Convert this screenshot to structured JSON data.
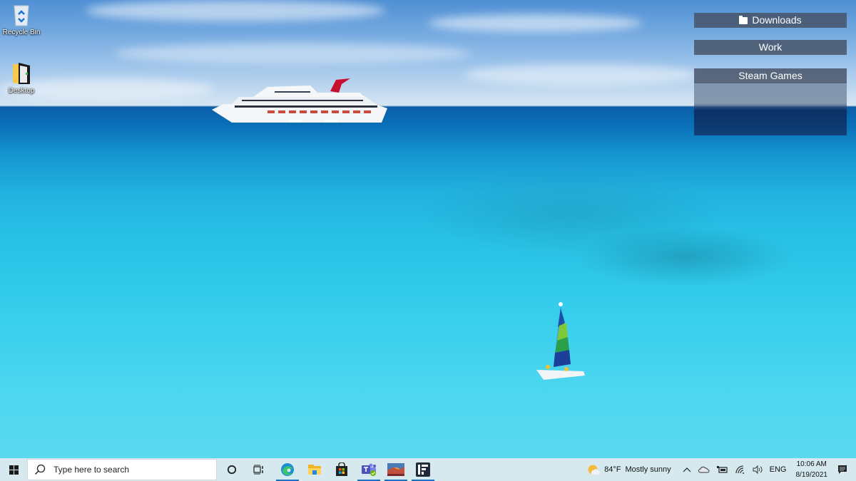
{
  "desktop": {
    "icons": [
      {
        "label": "Recycle Bin",
        "icon": "recycle-bin-icon"
      },
      {
        "label": "Desktop",
        "icon": "folder-icon"
      }
    ],
    "fences": [
      {
        "title": "Downloads",
        "icon": "folder-icon"
      },
      {
        "title": "Work"
      },
      {
        "title": "Steam Games"
      }
    ]
  },
  "taskbar": {
    "search_placeholder": "Type here to search",
    "pinned_apps": [
      {
        "name": "Microsoft Edge",
        "icon": "edge-icon",
        "running": true
      },
      {
        "name": "File Explorer",
        "icon": "file-explorer-icon",
        "running": false
      },
      {
        "name": "Microsoft Store",
        "icon": "store-icon",
        "running": false
      },
      {
        "name": "Microsoft Teams",
        "icon": "teams-icon",
        "running": true
      },
      {
        "name": "Photos",
        "icon": "photos-icon",
        "running": true
      },
      {
        "name": "Fences",
        "icon": "fences-icon",
        "running": true
      }
    ],
    "weather": {
      "temp": "84°F",
      "condition": "Mostly sunny"
    },
    "tray": {
      "language": "ENG",
      "time": "10:06 AM",
      "date": "8/19/2021"
    }
  },
  "colors": {
    "taskbar_bg": "#d5e9ef",
    "fence_header": "#465064",
    "accent": "#1a73c4"
  }
}
